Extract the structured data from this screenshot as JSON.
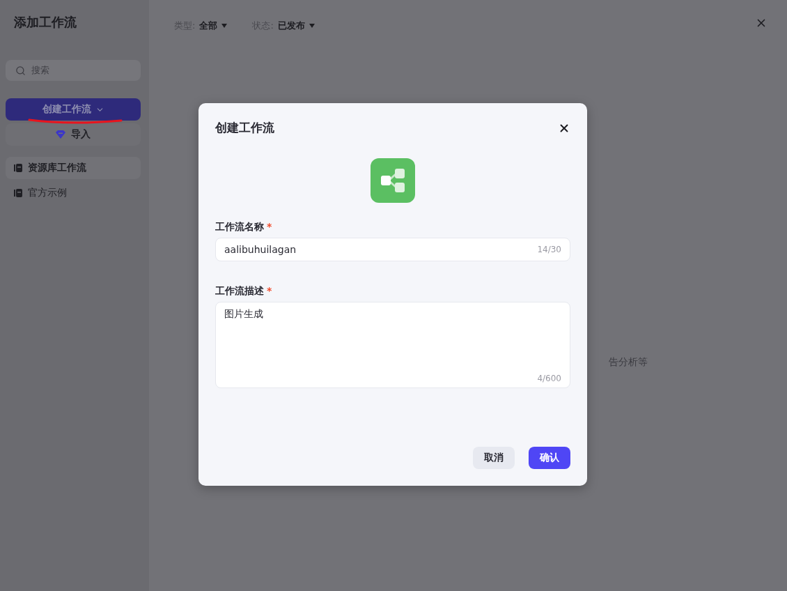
{
  "sidebar": {
    "title": "添加工作流",
    "search": {
      "placeholder": "搜索"
    },
    "create_button": "创建工作流",
    "import_button": "导入",
    "items": [
      {
        "label": "资源库工作流",
        "selected": true
      },
      {
        "label": "官方示例",
        "selected": false
      }
    ]
  },
  "filters": [
    {
      "label": "类型:",
      "value": "全部"
    },
    {
      "label": "状态:",
      "value": "已发布"
    }
  ],
  "background_text": "告分析等",
  "dialog": {
    "title": "创建工作流",
    "fields": [
      {
        "kind": "input",
        "label": "工作流名称",
        "required_mark": "*",
        "value": "aalibuhuilagan",
        "count": "14/30"
      },
      {
        "kind": "textarea",
        "label": "工作流描述",
        "required_mark": "*",
        "value": "图片生成",
        "count": "4/600"
      }
    ],
    "buttons": [
      {
        "label": "取消",
        "primary": false
      },
      {
        "label": "确认",
        "primary": true
      }
    ]
  }
}
